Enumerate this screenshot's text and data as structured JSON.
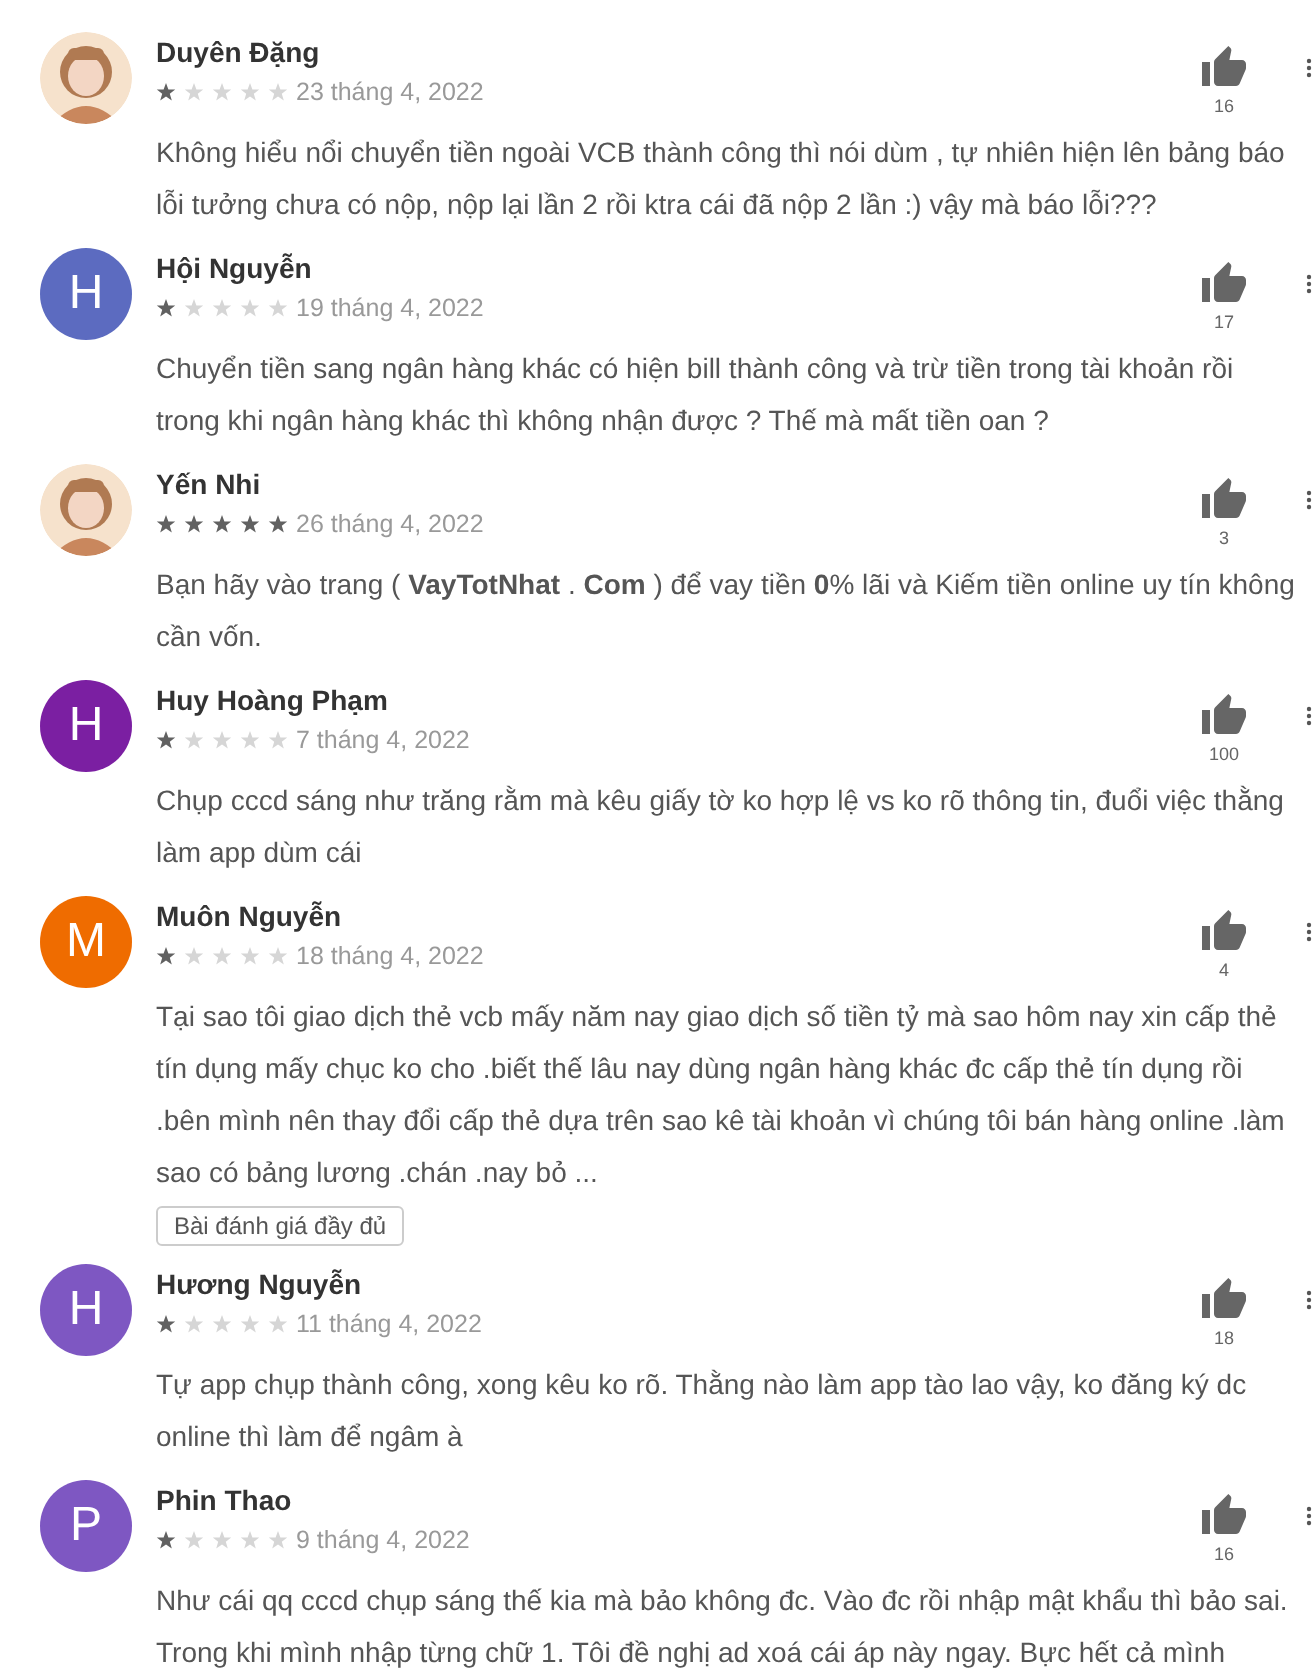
{
  "reviews": [
    {
      "name": "Duyên Đặng",
      "stars": 1,
      "date": "23 tháng 4, 2022",
      "likes": "16",
      "text": "Không hiểu nổi chuyển tiền ngoài VCB thành công thì nói dùm , tự nhiên hiện lên bảng báo lỗi tưởng chưa có nộp, nộp lại lần 2 rồi ktra cái đã nộp 2 lần :) vậy mà báo lỗi???"
    },
    {
      "name": "Hội Nguyễn",
      "avatar": {
        "kind": "letter",
        "letter": "H",
        "color": "#5c6bc0"
      },
      "stars": 1,
      "date": "19 tháng 4, 2022",
      "likes": "17",
      "text": "Chuyển tiền sang ngân hàng khác có hiện bill thành công và trừ tiền trong tài khoản rồi trong khi ngân hàng khác thì không nhận được ? Thế mà mất tiền oan ?"
    },
    {
      "name": "Yến Nhi",
      "stars": 5,
      "date": "26 tháng 4, 2022",
      "likes": "3",
      "text": "Bạn hãy vào trang ( **VayTotNhat** . **Com** ) để vay tiền **0**% lãi và Kiếm tiền online uy tín không cần vốn."
    },
    {
      "name": "Huy Hoàng Phạm",
      "avatar": {
        "kind": "letter",
        "letter": "H",
        "color": "#7b1fa2"
      },
      "stars": 1,
      "date": "7 tháng 4, 2022",
      "likes": "100",
      "text": "Chụp cccd sáng như trăng rằm mà kêu giấy tờ ko hợp lệ vs ko rõ thông tin, đuổi việc thằng làm app dùm cái"
    },
    {
      "name": "Muôn Nguyễn",
      "avatar": {
        "kind": "letter",
        "letter": "M",
        "color": "#ef6c00"
      },
      "stars": 1,
      "date": "18 tháng 4, 2022",
      "likes": "4",
      "text": "Tại sao tôi giao dịch thẻ vcb mấy năm nay giao dịch số tiền tỷ mà sao hôm nay xin cấp thẻ tín dụng mấy chục ko cho .biết thế lâu nay dùng ngân hàng khác đc cấp thẻ tín dụng rồi .bên mình nên thay đổi cấp thẻ dựa trên sao kê tài khoản vì chúng tôi bán hàng online .làm sao có bảng lương .chán .nay bỏ ...",
      "full_review_button": "Bài đánh giá đầy đủ"
    },
    {
      "name": "Hương Nguyễn",
      "avatar": {
        "kind": "letter",
        "letter": "H",
        "color": "#7e57c2"
      },
      "stars": 1,
      "date": "11 tháng 4, 2022",
      "likes": "18",
      "text": "Tự app chụp thành công, xong kêu ko rõ. Thằng nào làm app tào lao vậy, ko đăng ký dc online thì làm để ngâm à"
    },
    {
      "name": "Phin Thao",
      "avatar": {
        "kind": "letter",
        "letter": "P",
        "color": "#7e57c2"
      },
      "stars": 1,
      "date": "9 tháng 4, 2022",
      "likes": "16",
      "text": "Như cái qq cccd chụp sáng thế kia mà bảo không đc. Vào đc rồi nhập mật khẩu thì bảo sai. Trong khi mình nhập từng chữ 1. Tôi đề nghị ad xoá cái áp này ngay. Bực hết cả mình"
    }
  ]
}
